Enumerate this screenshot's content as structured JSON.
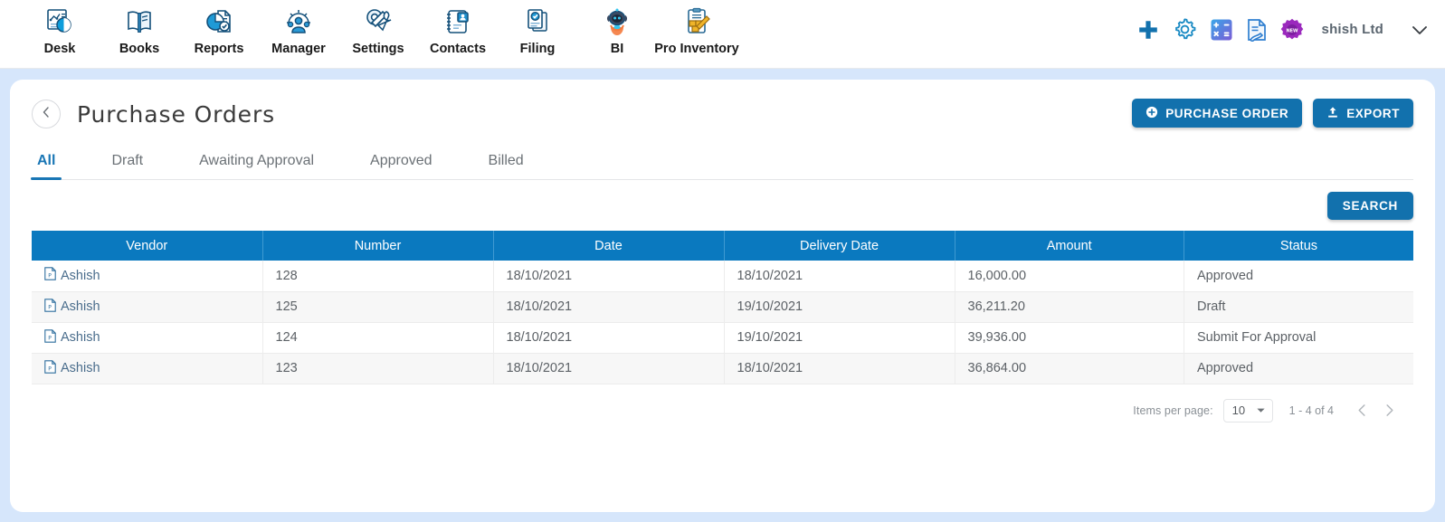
{
  "topnav": {
    "items": [
      {
        "label": "Desk",
        "icon": "desk-dashboard-icon"
      },
      {
        "label": "Books",
        "icon": "books-open-book-icon"
      },
      {
        "label": "Reports",
        "icon": "reports-piechart-icon"
      },
      {
        "label": "Manager",
        "icon": "manager-people-gear-icon"
      },
      {
        "label": "Settings",
        "icon": "settings-tools-icon"
      },
      {
        "label": "Contacts",
        "icon": "contacts-address-book-icon"
      },
      {
        "label": "Filing",
        "icon": "filing-documents-icon"
      },
      {
        "label": "BI",
        "icon": "bi-robot-icon"
      },
      {
        "label": "Pro Inventory",
        "icon": "pro-inventory-clipboard-boxes-icon"
      }
    ],
    "right": {
      "add_icon": "plus-icon",
      "settings_icon": "gear-icon",
      "calculator_icon": "calculator-icon",
      "notes_icon": "notes-document-icon",
      "new_badge_icon": "new-badge-icon",
      "new_badge_text": "NEW",
      "user_name": "shish Ltd",
      "caret_icon": "chevron-down-icon"
    }
  },
  "header": {
    "back_icon": "chevron-left-icon",
    "title": "Purchase Orders",
    "purchase_order_button": "PURCHASE ORDER",
    "purchase_order_icon": "plus-circle-icon",
    "export_button": "EXPORT",
    "export_icon": "upload-icon"
  },
  "tabs": [
    {
      "label": "All",
      "active": true
    },
    {
      "label": "Draft",
      "active": false
    },
    {
      "label": "Awaiting Approval",
      "active": false
    },
    {
      "label": "Approved",
      "active": false
    },
    {
      "label": "Billed",
      "active": false
    }
  ],
  "toolbar": {
    "search_button": "SEARCH"
  },
  "table": {
    "columns": [
      "Vendor",
      "Number",
      "Date",
      "Delivery Date",
      "Amount",
      "Status"
    ],
    "row_icon": "purchase-order-document-icon",
    "rows": [
      {
        "vendor": "Ashish",
        "number": "128",
        "date": "18/10/2021",
        "delivery_date": "18/10/2021",
        "amount": "16,000.00",
        "status": "Approved"
      },
      {
        "vendor": "Ashish",
        "number": "125",
        "date": "18/10/2021",
        "delivery_date": "19/10/2021",
        "amount": "36,211.20",
        "status": "Draft"
      },
      {
        "vendor": "Ashish",
        "number": "124",
        "date": "18/10/2021",
        "delivery_date": "19/10/2021",
        "amount": "39,936.00",
        "status": "Submit For Approval"
      },
      {
        "vendor": "Ashish",
        "number": "123",
        "date": "18/10/2021",
        "delivery_date": "18/10/2021",
        "amount": "36,864.00",
        "status": "Approved"
      }
    ]
  },
  "paginator": {
    "items_per_page_label": "Items per page:",
    "items_per_page_value": "10",
    "dropdown_icon": "chevron-down-icon",
    "range": "1 - 4 of 4",
    "prev_icon": "chevron-left-icon",
    "next_icon": "chevron-right-icon"
  },
  "colors": {
    "accent": "#1271ad",
    "table_header": "#0a79bf",
    "page_background": "#d6e6fb",
    "tab_active": "#1976b5"
  }
}
